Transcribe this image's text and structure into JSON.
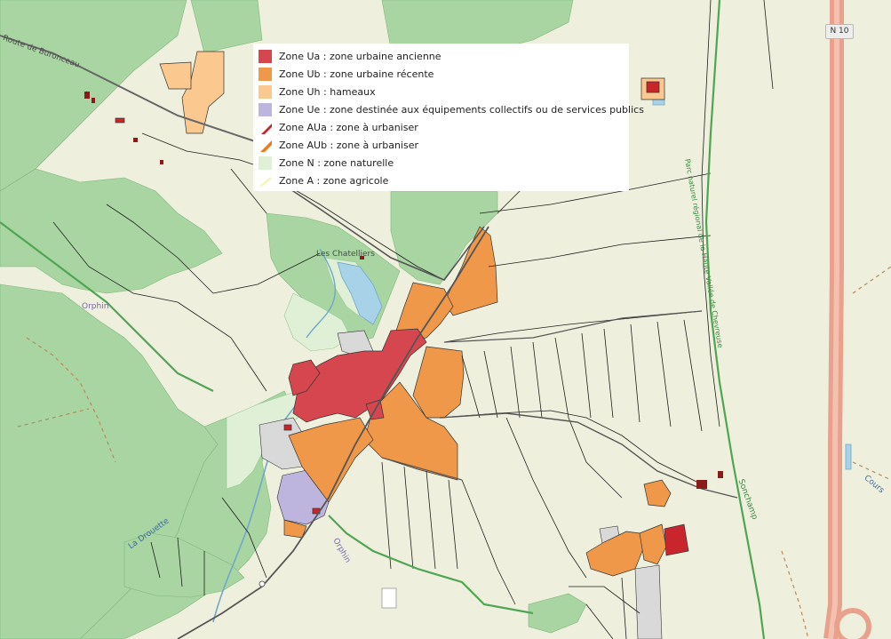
{
  "legend": {
    "items": [
      {
        "label": "Zone Ua : zone urbaine ancienne",
        "color": "#d6464e",
        "shape": "square"
      },
      {
        "label": "Zone Ub : zone urbaine récente",
        "color": "#f0984a",
        "shape": "square"
      },
      {
        "label": "Zone Uh : hameaux",
        "color": "#fbc98f",
        "shape": "square"
      },
      {
        "label": "Zone Ue : zone destinée aux équipements collectifs ou de services publics",
        "color": "#bdb5dd",
        "shape": "square"
      },
      {
        "label": "Zone AUa : zone à urbaniser",
        "color": "#c9252c",
        "shape": "triangle"
      },
      {
        "label": "Zone AUb : zone à urbaniser",
        "color": "#ee7a1c",
        "shape": "triangle"
      },
      {
        "label": "Zone N : zone naturelle",
        "color": "#dff0d6",
        "shape": "square"
      },
      {
        "label": "Zone A : zone agricole",
        "color": "#f7f3a8",
        "shape": "line"
      }
    ]
  },
  "map_labels": {
    "road_shield": "N 10",
    "hamlet": "Les Chatelliers",
    "stream_west": "Orphin",
    "stream_south": "Orphin",
    "road_northwest": "Route de Buronceau",
    "park_boundary": "Parc naturel régional de la Haute Vallée de Chevreuse",
    "sonchamp": "Sonchamp",
    "stream_bottom": "La Drouette",
    "stream_east": "Cours"
  },
  "colors": {
    "agricultural": "#eef0dd",
    "forest": "#a9d5a3",
    "road_major": "#e9a08d",
    "park_boundary": "#4fa553",
    "parcel_line": "#1e1e1e",
    "water": "#a8d2e8"
  }
}
